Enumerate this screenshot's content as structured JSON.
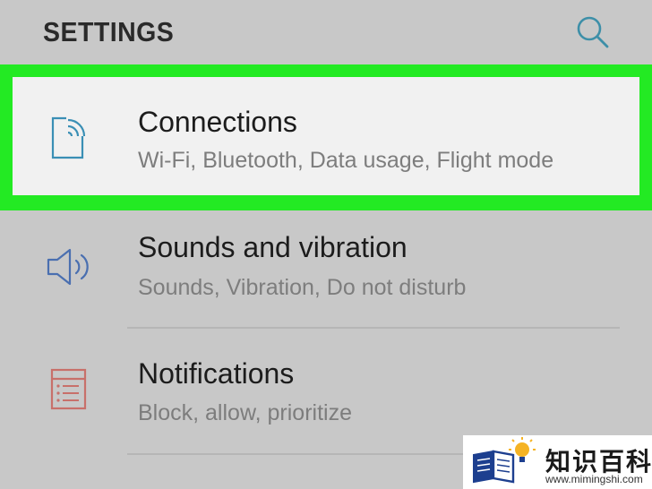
{
  "header": {
    "title": "SETTINGS",
    "search_icon": "search-icon"
  },
  "settings_items": [
    {
      "title": "Connections",
      "subtitle": "Wi-Fi, Bluetooth, Data usage, Flight mode",
      "icon": "connections-icon",
      "icon_color": "#3a8fb5",
      "highlighted": true,
      "highlight_color": "#23ea23"
    },
    {
      "title": "Sounds and vibration",
      "subtitle": "Sounds, Vibration, Do not disturb",
      "icon": "speaker-icon",
      "icon_color": "#4a6fb0"
    },
    {
      "title": "Notifications",
      "subtitle": "Block, allow, prioritize",
      "icon": "notifications-icon",
      "icon_color": "#c8706a"
    }
  ],
  "watermark": {
    "name": "知识百科",
    "url": "www.mimingshi.com",
    "icon": "book-bulb-icon"
  }
}
